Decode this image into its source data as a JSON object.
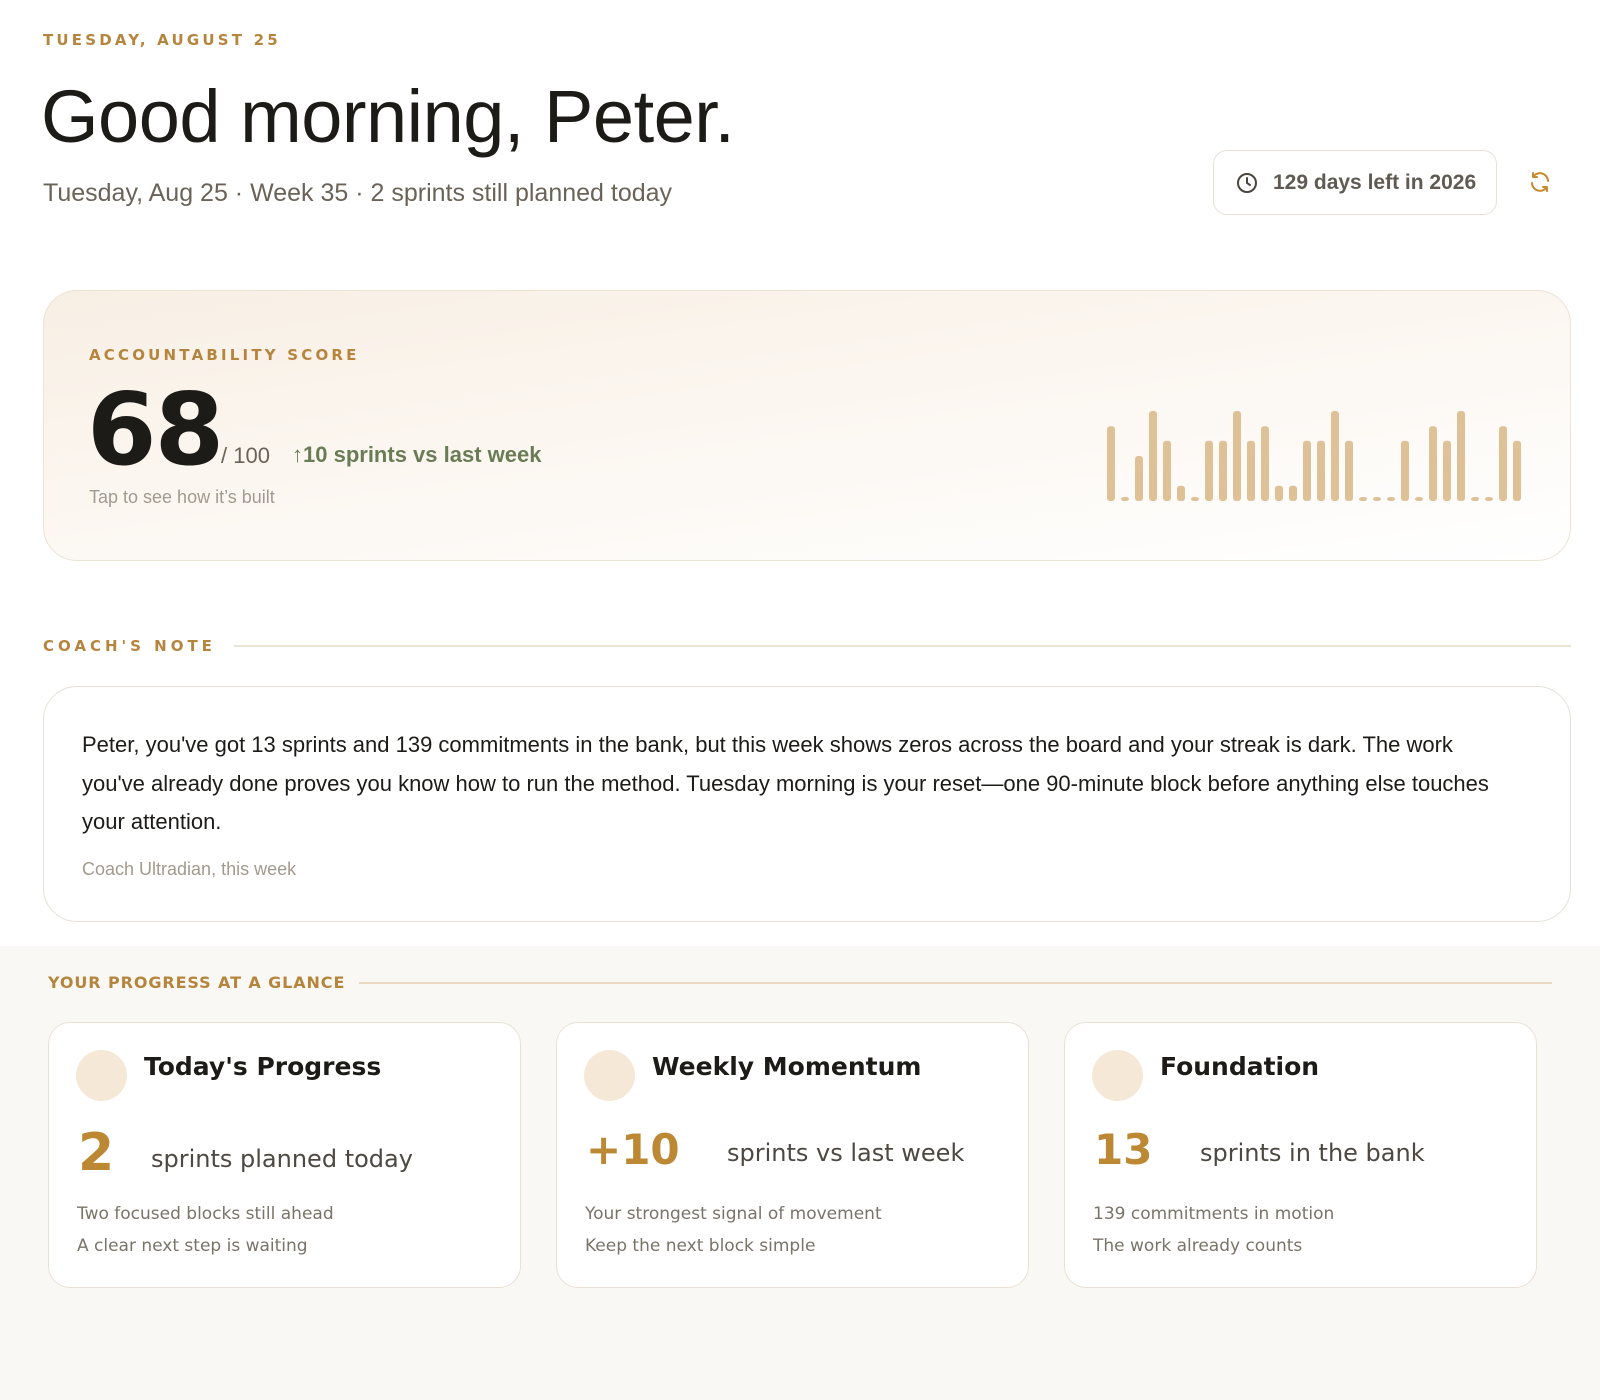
{
  "header": {
    "dateline": "TUESDAY, AUGUST 25",
    "greeting": "Good morning, Peter.",
    "subline": "Tuesday, Aug 25 · Week 35 · 2 sprints still planned today",
    "days_left": "129 days left in 2026",
    "clock_icon": "clock-icon",
    "refresh_icon": "refresh-icon"
  },
  "score": {
    "label": "ACCOUNTABILITY SCORE",
    "value": "68",
    "max": "/ 100",
    "delta": "↑10 sprints vs last week",
    "hint": "Tap to see how it’s built",
    "bar_color": "#dfc198",
    "bars": [
      0.83,
      0.03,
      0.5,
      1.0,
      0.67,
      0.17,
      0.03,
      0.67,
      0.67,
      1.0,
      0.67,
      0.83,
      0.17,
      0.17,
      0.67,
      0.67,
      1.0,
      0.67,
      0.03,
      0.03,
      0.03,
      0.67,
      0.03,
      0.83,
      0.67,
      1.0,
      0.03,
      0.03,
      0.83,
      0.67
    ]
  },
  "coach": {
    "section_label": "COACH'S NOTE",
    "text": "Peter, you've got 13 sprints and 139 commitments in the bank, but this week shows zeros across the board and your streak is dark. The work you've already done proves you know how to run the method. Tuesday morning is your reset—one 90-minute block before anything else touches your attention.",
    "signature": "Coach Ultradian, this week"
  },
  "glance": {
    "section_label": "YOUR PROGRESS AT A GLANCE",
    "cards": [
      {
        "title": "Today's Progress",
        "value": "2",
        "unit": "sprints planned today",
        "line1": "Two focused blocks still ahead",
        "line2": "A clear next step is waiting"
      },
      {
        "title": "Weekly Momentum",
        "value": "+10",
        "unit": "sprints vs last week",
        "line1": "Your strongest signal of movement",
        "line2": "Keep the next block simple"
      },
      {
        "title": "Foundation",
        "value": "13",
        "unit": "sprints in the bank",
        "line1": "139 commitments in motion",
        "line2": "The work already counts"
      }
    ]
  },
  "colors": {
    "accent": "#b5853e",
    "positive": "#6a7c55",
    "big_number": "#bd8834"
  }
}
